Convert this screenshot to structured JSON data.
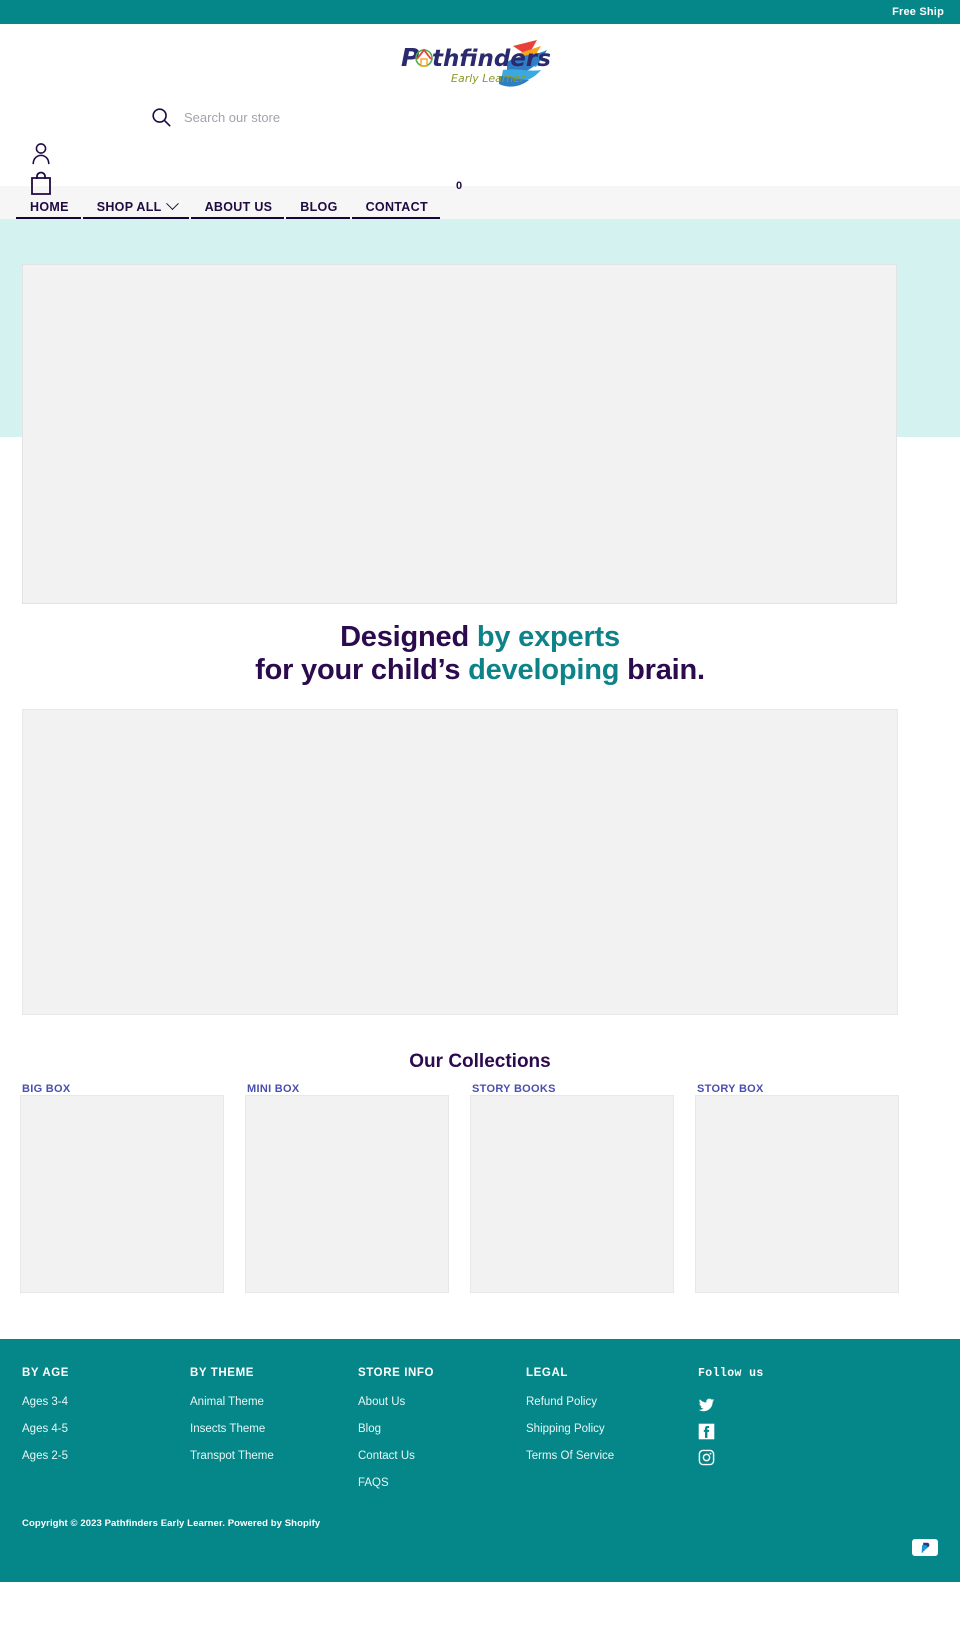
{
  "announcement": {
    "text": "Free Ship"
  },
  "header": {
    "logo": {
      "name": "Pathfinders",
      "tagline": "Early Learner"
    },
    "search": {
      "placeholder": "Search our store",
      "value": "",
      "icon": "search-icon"
    },
    "account_icon": "user-icon",
    "cart_icon": "bag-icon",
    "cart_count": "0"
  },
  "nav": {
    "items": [
      {
        "label": "HOME",
        "has_chevron": false
      },
      {
        "label": "SHOP ALL",
        "has_chevron": true
      },
      {
        "label": "ABOUT US",
        "has_chevron": false
      },
      {
        "label": "BLOG",
        "has_chevron": false
      },
      {
        "label": "CONTACT",
        "has_chevron": false
      }
    ]
  },
  "hero": {
    "image_alt": ""
  },
  "headline": {
    "line1_a": "Designed ",
    "line1_b": "by experts",
    "line2_a": "for your child’s ",
    "line2_b": "developing",
    "line2_c": " brain."
  },
  "feature": {
    "image_alt": ""
  },
  "collections": {
    "title": "Our Collections",
    "items": [
      {
        "label": "BIG BOX"
      },
      {
        "label": "MINI BOX"
      },
      {
        "label": "STORY BOOKS"
      },
      {
        "label": "STORY BOX"
      }
    ]
  },
  "footer": {
    "columns": [
      {
        "heading": "BY AGE",
        "links": [
          {
            "label": "Ages 3-4"
          },
          {
            "label": "Ages 4-5"
          },
          {
            "label": "Ages 2-5"
          }
        ]
      },
      {
        "heading": "BY THEME",
        "links": [
          {
            "label": "Animal Theme"
          },
          {
            "label": "Insects Theme"
          },
          {
            "label": "Transpot Theme"
          }
        ]
      },
      {
        "heading": "STORE INFO",
        "links": [
          {
            "label": "About Us"
          },
          {
            "label": "Blog"
          },
          {
            "label": "Contact Us"
          },
          {
            "label": "FAQS"
          }
        ]
      },
      {
        "heading": "LEGAL",
        "links": [
          {
            "label": "Refund Policy"
          },
          {
            "label": "Shipping Policy"
          },
          {
            "label": "Terms Of Service"
          }
        ]
      }
    ],
    "social": {
      "heading": "Follow us",
      "icons": [
        "twitter-icon",
        "facebook-icon",
        "instagram-icon"
      ]
    },
    "copyright": "Copyright © 2023 Pathfinders Early Learner. Powered by Shopify",
    "payment_icon": "paypal-icon"
  },
  "colors": {
    "brand_teal": "#058789",
    "hero_mint": "#d4f2f0",
    "deep_purple": "#2b0a4e",
    "accent_teal": "#0d8389",
    "collection_label": "#4a4fb0",
    "nav_bg": "#f6f6f7"
  }
}
